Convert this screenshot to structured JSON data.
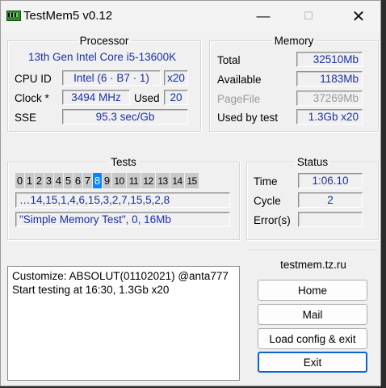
{
  "window": {
    "title": "TestMem5 v0.12",
    "controls": {
      "minimize": "—",
      "maximize": "☐",
      "close": "✕"
    }
  },
  "processor": {
    "legend": "Processor",
    "name": "13th Gen Intel Core i5-13600K",
    "cpuid_label": "CPU ID",
    "cpuid_value": "Intel  (6 · B7 · 1)",
    "cpuid_threads": "x20",
    "clock_label": "Clock *",
    "clock_value": "3494 MHz",
    "used_label": "Used",
    "used_value": "20",
    "sse_label": "SSE",
    "sse_value": "95.3 sec/Gb"
  },
  "memory": {
    "legend": "Memory",
    "total_label": "Total",
    "total_value": "32510Mb",
    "available_label": "Available",
    "available_value": "1183Mb",
    "pagefile_label": "PageFile",
    "pagefile_value": "37269Mb",
    "used_by_test_label": "Used by test",
    "used_by_test_value": "1.3Gb x20"
  },
  "tests": {
    "legend": "Tests",
    "numbers": [
      "0",
      "1",
      "2",
      "3",
      "4",
      "5",
      "6",
      "7",
      "8",
      "9",
      "10",
      "11",
      "12",
      "13",
      "14",
      "15"
    ],
    "active_index": 8,
    "sequence": "…14,15,1,4,6,15,3,2,7,15,5,2,8",
    "current": "\"Simple Memory Test\", 0, 16Mb"
  },
  "status": {
    "legend": "Status",
    "time_label": "Time",
    "time_value": "1:06.10",
    "cycle_label": "Cycle",
    "cycle_value": "2",
    "errors_label": "Error(s)",
    "errors_value": ""
  },
  "log": {
    "lines": [
      "Customize: ABSOLUT(01102021) @anta777",
      "Start testing at 16:30, 1.3Gb x20"
    ]
  },
  "side": {
    "site": "testmem.tz.ru",
    "home_label": "Home",
    "mail_label": "Mail",
    "load_label": "Load config & exit",
    "exit_label": "Exit"
  }
}
